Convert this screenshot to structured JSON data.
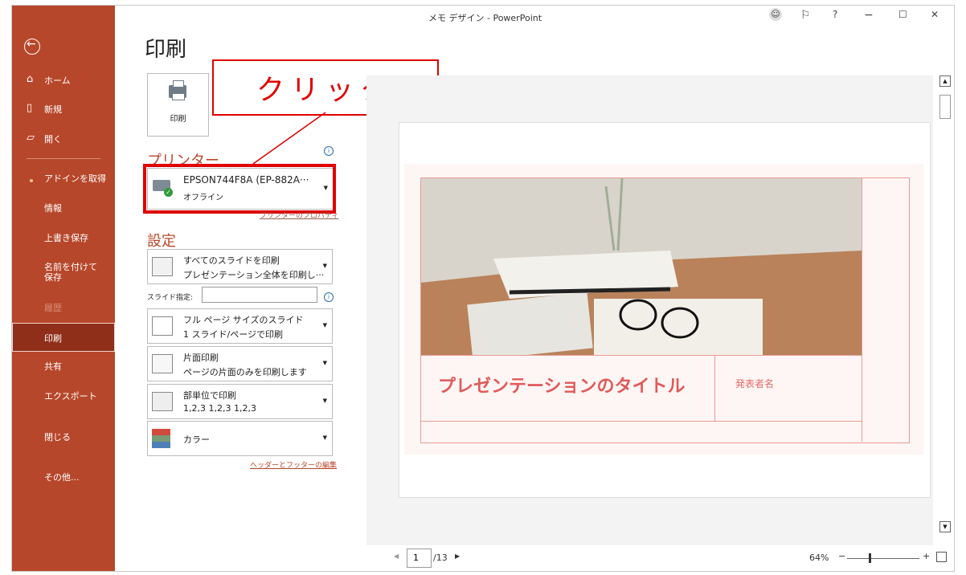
{
  "window": {
    "title": "メモ デザイン - PowerPoint",
    "help": "?",
    "minimize": "−",
    "maximize": "☐",
    "close": "✕"
  },
  "sidebar": {
    "home": "ホーム",
    "new": "新規",
    "open": "開く",
    "addins": "アドインを取得",
    "info": "情報",
    "save": "上書き保存",
    "save_as": "名前を付けて保存",
    "history": "履歴",
    "print": "印刷",
    "share": "共有",
    "export": "エクスポート",
    "close": "閉じる",
    "more": "その他..."
  },
  "page": {
    "title": "印刷"
  },
  "print_button": {
    "label": "印刷"
  },
  "callout": {
    "text": "クリック"
  },
  "printer": {
    "heading": "プリンター",
    "name": "EPSON744F8A (EP-882A···",
    "status": "オフライン",
    "properties_link": "プリンターのプロパティ"
  },
  "settings": {
    "heading": "設定",
    "range_l1": "すべてのスライドを印刷",
    "range_l2": "プレゼンテーション全体を印刷し···",
    "slides_label": "スライド指定:",
    "layout_l1": "フル ページ サイズのスライド",
    "layout_l2": "1 スライド/ページで印刷",
    "sides_l1": "片面印刷",
    "sides_l2": "ページの片面のみを印刷します",
    "collate_l1": "部単位で印刷",
    "collate_l2": "1,2,3    1,2,3    1,2,3",
    "color_l1": "カラー",
    "header_footer_link": "ヘッダーとフッターの編集"
  },
  "preview": {
    "slide_title": "プレゼンテーションのタイトル",
    "presenter": "発表者名",
    "page_current": "1",
    "page_total": "/13",
    "zoom": "64%"
  },
  "colors": {
    "accent": "#b7472a",
    "highlight": "#e00000"
  }
}
